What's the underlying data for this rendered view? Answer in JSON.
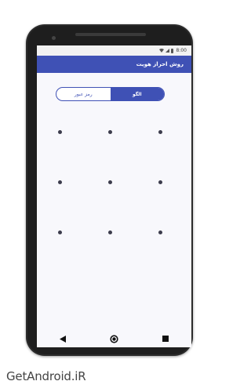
{
  "status_bar": {
    "time": "8:00"
  },
  "app_bar": {
    "title": "روش احراز هویت"
  },
  "auth_toggle": {
    "options": [
      {
        "label": "الگو",
        "selected": true
      },
      {
        "label": "رمز عبور",
        "selected": false
      }
    ]
  },
  "pattern": {
    "rows": 3,
    "cols": 3
  },
  "watermark": {
    "text": "GetAndroid.iR"
  },
  "colors": {
    "primary": "#3f51b5",
    "dot": "#3c3c4c"
  },
  "icons": {
    "back": "back-triangle-icon",
    "home": "home-circle-icon",
    "recents": "recents-square-icon"
  }
}
